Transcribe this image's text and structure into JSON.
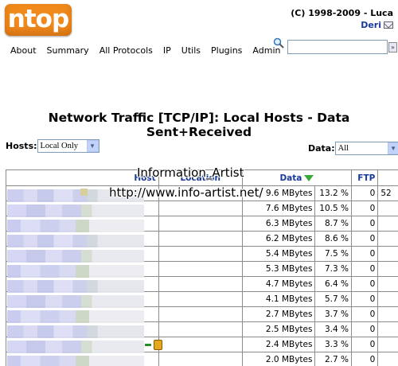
{
  "header": {
    "logo_text": "ntop",
    "copyright": "(C) 1998-2009 - Luca",
    "author": "Deri"
  },
  "menu": [
    "About",
    "Summary",
    "All Protocols",
    "IP",
    "Utils",
    "Plugins",
    "Admin"
  ],
  "search": {
    "placeholder": "",
    "go_label": "»"
  },
  "page_title": "Network Traffic [TCP/IP]: Local Hosts - Data Sent+Received",
  "filters": {
    "hosts_label": "Hosts:",
    "hosts_value": "Local Only",
    "data_label": "Data:",
    "data_value": "All"
  },
  "table": {
    "headers": {
      "host": "Host",
      "location": "Location",
      "data": "Data",
      "ftp": "FTP"
    },
    "rows": [
      {
        "data": "9.6 MBytes",
        "pct": "13.2 %",
        "ftp": "0",
        "extra": "52"
      },
      {
        "data": "7.6 MBytes",
        "pct": "10.5 %",
        "ftp": "0",
        "extra": ""
      },
      {
        "data": "6.3 MBytes",
        "pct": "8.7 %",
        "ftp": "0",
        "extra": ""
      },
      {
        "data": "6.2 MBytes",
        "pct": "8.6 %",
        "ftp": "0",
        "extra": ""
      },
      {
        "data": "5.4 MBytes",
        "pct": "7.5 %",
        "ftp": "0",
        "extra": ""
      },
      {
        "data": "5.3 MBytes",
        "pct": "7.3 %",
        "ftp": "0",
        "extra": ""
      },
      {
        "data": "4.7 MBytes",
        "pct": "6.4 %",
        "ftp": "0",
        "extra": ""
      },
      {
        "data": "4.1 MBytes",
        "pct": "5.7 %",
        "ftp": "0",
        "extra": ""
      },
      {
        "data": "2.7 MBytes",
        "pct": "3.7 %",
        "ftp": "0",
        "extra": ""
      },
      {
        "data": "2.5 MBytes",
        "pct": "3.4 %",
        "ftp": "0",
        "extra": ""
      },
      {
        "data": "2.4 MBytes",
        "pct": "3.3 %",
        "ftp": "0",
        "extra": ""
      },
      {
        "data": "2.0 MBytes",
        "pct": "2.7 %",
        "ftp": "0",
        "extra": ""
      }
    ]
  },
  "watermark": {
    "line1": "Information_Artist",
    "line2": "http://www.info-artist.net/"
  },
  "colors": {
    "logo": "#f08a1c",
    "link": "#1a3a9a",
    "sort_arrow": "#3aa83a"
  }
}
